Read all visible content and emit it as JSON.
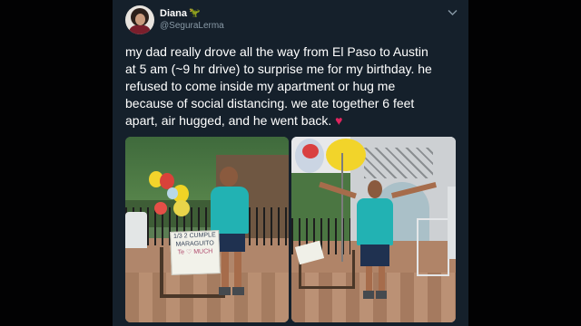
{
  "tweet": {
    "display_name": "Diana",
    "name_emoji": "🦖",
    "handle": "@SeguraLerma",
    "menu_icon": "chevron-down-icon",
    "text_line_1": "my dad really drove all the way from El Paso to Austin",
    "text_line_2": "at 5 am (~9 hr drive) to surprise me for my birthday. he",
    "text_line_3": "refused to come inside my apartment or hug me",
    "text_line_4": "because of social distancing. we ate together 6 feet",
    "text_line_5": "apart, air hugged, and he went back.",
    "heart": "♥"
  },
  "media": {
    "photo_1_sign_line_1": "1/3 2 CUMPLE",
    "photo_1_sign_line_2": "MARAGUITO",
    "photo_1_sign_line_3": "Te ♡ MUCH"
  },
  "colors": {
    "page_background": "#020203",
    "card_background": "#15202b",
    "text_primary": "#ffffff",
    "text_secondary": "#8899a6",
    "heart": "#e0245e",
    "shirt_teal": "#22b2b3"
  }
}
